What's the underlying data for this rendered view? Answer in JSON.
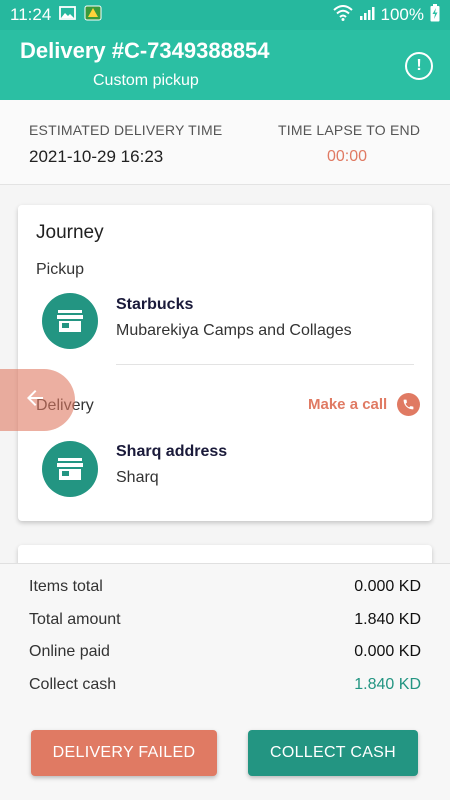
{
  "status_bar": {
    "time": "11:24",
    "battery_percent": "100%",
    "icons": [
      "image-icon",
      "game-app-icon",
      "wifi-icon",
      "signal-icon",
      "battery-charging-icon"
    ]
  },
  "header": {
    "title": "Delivery #C-7349388854",
    "subtitle": "Custom pickup",
    "info_icon": "info-icon",
    "background_color": "#2bbfa3"
  },
  "timing": {
    "estimated_label": "ESTIMATED DELIVERY TIME",
    "estimated_value": "2021-10-29 16:23",
    "lapse_label": "TIME LAPSE TO END",
    "lapse_value": "00:00"
  },
  "journey": {
    "title": "Journey",
    "pickup": {
      "label": "Pickup",
      "name": "Starbucks",
      "address": "Mubarekiya Camps and Collages",
      "icon": "store-icon"
    },
    "delivery": {
      "label": "Delivery",
      "name": "Sharq address",
      "address": "Sharq",
      "icon": "store-icon",
      "call_label": "Make a call",
      "call_icon": "phone-icon"
    }
  },
  "summary": {
    "rows": [
      {
        "label": "Items total",
        "value": "0.000 KD"
      },
      {
        "label": "Total amount",
        "value": "1.840 KD"
      },
      {
        "label": "Online paid",
        "value": "0.000 KD"
      },
      {
        "label": "Collect cash",
        "value": "1.840 KD"
      }
    ],
    "failed_button": "DELIVERY FAILED",
    "collect_button": "COLLECT CASH"
  },
  "colors": {
    "accent": "#239582",
    "warning": "#e07a63"
  }
}
